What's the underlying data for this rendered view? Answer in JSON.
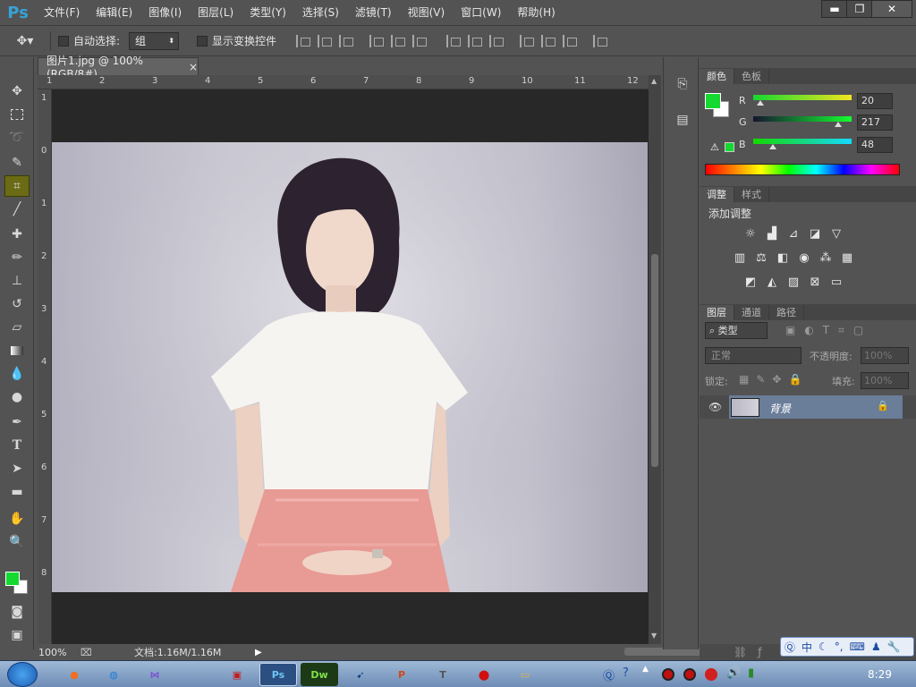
{
  "app": {
    "logo": "Ps"
  },
  "menu": [
    "文件(F)",
    "编辑(E)",
    "图像(I)",
    "图层(L)",
    "类型(Y)",
    "选择(S)",
    "滤镜(T)",
    "视图(V)",
    "窗口(W)",
    "帮助(H)"
  ],
  "window_controls": {
    "minimize": "▬",
    "restore": "❐",
    "close": "✕"
  },
  "options_bar": {
    "auto_select_label": "自动选择:",
    "auto_select_value": "组",
    "show_transform_label": "显示变换控件"
  },
  "document": {
    "tab_title": "图片1.jpg @ 100%(RGB/8#)",
    "tab_close": "×",
    "ruler_top": [
      "1",
      "2",
      "3",
      "4",
      "5",
      "6",
      "7",
      "8",
      "9",
      "10",
      "11",
      "12"
    ],
    "ruler_left": [
      "1",
      "0",
      "1",
      "2",
      "3",
      "4",
      "5",
      "6",
      "7",
      "8"
    ]
  },
  "status": {
    "zoom": "100%",
    "doc_info": "文档:1.16M/1.16M"
  },
  "color_panel": {
    "tabs": [
      "颜色",
      "色板"
    ],
    "r_label": "R",
    "g_label": "G",
    "b_label": "B",
    "r_value": "20",
    "g_value": "217",
    "b_value": "48",
    "foreground_color": "#14d930",
    "background_color": "#ffffff"
  },
  "adjust_panel": {
    "tabs": [
      "调整",
      "样式"
    ],
    "title": "添加调整"
  },
  "layers_panel": {
    "tabs": [
      "图层",
      "通道",
      "路径"
    ],
    "filter_label": "类型",
    "blend_mode": "正常",
    "opacity_label": "不透明度:",
    "opacity_value": "100%",
    "lock_label": "锁定:",
    "fill_label": "填充:",
    "fill_value": "100%",
    "layers": [
      {
        "name": "背景"
      }
    ]
  },
  "ime_bar": {
    "mode": "中"
  },
  "taskbar": {
    "clock": "8:29"
  },
  "accent": {
    "selected_tool": "#6b6b16",
    "layer_selected": "#6a7d99"
  }
}
